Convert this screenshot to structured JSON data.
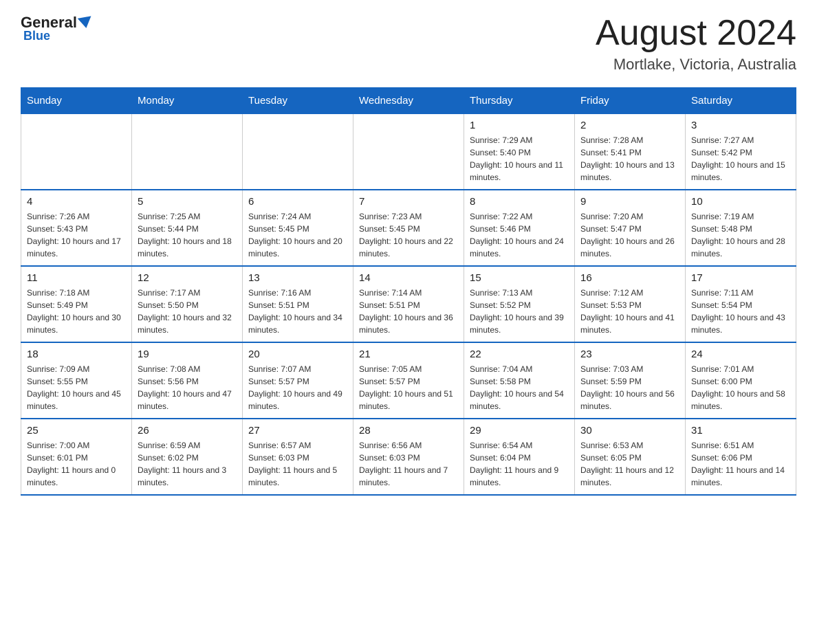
{
  "header": {
    "logo_general": "General",
    "logo_triangle": "",
    "logo_blue": "Blue",
    "month_year": "August 2024",
    "location": "Mortlake, Victoria, Australia"
  },
  "days_of_week": [
    "Sunday",
    "Monday",
    "Tuesday",
    "Wednesday",
    "Thursday",
    "Friday",
    "Saturday"
  ],
  "weeks": [
    [
      {
        "day": "",
        "info": ""
      },
      {
        "day": "",
        "info": ""
      },
      {
        "day": "",
        "info": ""
      },
      {
        "day": "",
        "info": ""
      },
      {
        "day": "1",
        "info": "Sunrise: 7:29 AM\nSunset: 5:40 PM\nDaylight: 10 hours and 11 minutes."
      },
      {
        "day": "2",
        "info": "Sunrise: 7:28 AM\nSunset: 5:41 PM\nDaylight: 10 hours and 13 minutes."
      },
      {
        "day": "3",
        "info": "Sunrise: 7:27 AM\nSunset: 5:42 PM\nDaylight: 10 hours and 15 minutes."
      }
    ],
    [
      {
        "day": "4",
        "info": "Sunrise: 7:26 AM\nSunset: 5:43 PM\nDaylight: 10 hours and 17 minutes."
      },
      {
        "day": "5",
        "info": "Sunrise: 7:25 AM\nSunset: 5:44 PM\nDaylight: 10 hours and 18 minutes."
      },
      {
        "day": "6",
        "info": "Sunrise: 7:24 AM\nSunset: 5:45 PM\nDaylight: 10 hours and 20 minutes."
      },
      {
        "day": "7",
        "info": "Sunrise: 7:23 AM\nSunset: 5:45 PM\nDaylight: 10 hours and 22 minutes."
      },
      {
        "day": "8",
        "info": "Sunrise: 7:22 AM\nSunset: 5:46 PM\nDaylight: 10 hours and 24 minutes."
      },
      {
        "day": "9",
        "info": "Sunrise: 7:20 AM\nSunset: 5:47 PM\nDaylight: 10 hours and 26 minutes."
      },
      {
        "day": "10",
        "info": "Sunrise: 7:19 AM\nSunset: 5:48 PM\nDaylight: 10 hours and 28 minutes."
      }
    ],
    [
      {
        "day": "11",
        "info": "Sunrise: 7:18 AM\nSunset: 5:49 PM\nDaylight: 10 hours and 30 minutes."
      },
      {
        "day": "12",
        "info": "Sunrise: 7:17 AM\nSunset: 5:50 PM\nDaylight: 10 hours and 32 minutes."
      },
      {
        "day": "13",
        "info": "Sunrise: 7:16 AM\nSunset: 5:51 PM\nDaylight: 10 hours and 34 minutes."
      },
      {
        "day": "14",
        "info": "Sunrise: 7:14 AM\nSunset: 5:51 PM\nDaylight: 10 hours and 36 minutes."
      },
      {
        "day": "15",
        "info": "Sunrise: 7:13 AM\nSunset: 5:52 PM\nDaylight: 10 hours and 39 minutes."
      },
      {
        "day": "16",
        "info": "Sunrise: 7:12 AM\nSunset: 5:53 PM\nDaylight: 10 hours and 41 minutes."
      },
      {
        "day": "17",
        "info": "Sunrise: 7:11 AM\nSunset: 5:54 PM\nDaylight: 10 hours and 43 minutes."
      }
    ],
    [
      {
        "day": "18",
        "info": "Sunrise: 7:09 AM\nSunset: 5:55 PM\nDaylight: 10 hours and 45 minutes."
      },
      {
        "day": "19",
        "info": "Sunrise: 7:08 AM\nSunset: 5:56 PM\nDaylight: 10 hours and 47 minutes."
      },
      {
        "day": "20",
        "info": "Sunrise: 7:07 AM\nSunset: 5:57 PM\nDaylight: 10 hours and 49 minutes."
      },
      {
        "day": "21",
        "info": "Sunrise: 7:05 AM\nSunset: 5:57 PM\nDaylight: 10 hours and 51 minutes."
      },
      {
        "day": "22",
        "info": "Sunrise: 7:04 AM\nSunset: 5:58 PM\nDaylight: 10 hours and 54 minutes."
      },
      {
        "day": "23",
        "info": "Sunrise: 7:03 AM\nSunset: 5:59 PM\nDaylight: 10 hours and 56 minutes."
      },
      {
        "day": "24",
        "info": "Sunrise: 7:01 AM\nSunset: 6:00 PM\nDaylight: 10 hours and 58 minutes."
      }
    ],
    [
      {
        "day": "25",
        "info": "Sunrise: 7:00 AM\nSunset: 6:01 PM\nDaylight: 11 hours and 0 minutes."
      },
      {
        "day": "26",
        "info": "Sunrise: 6:59 AM\nSunset: 6:02 PM\nDaylight: 11 hours and 3 minutes."
      },
      {
        "day": "27",
        "info": "Sunrise: 6:57 AM\nSunset: 6:03 PM\nDaylight: 11 hours and 5 minutes."
      },
      {
        "day": "28",
        "info": "Sunrise: 6:56 AM\nSunset: 6:03 PM\nDaylight: 11 hours and 7 minutes."
      },
      {
        "day": "29",
        "info": "Sunrise: 6:54 AM\nSunset: 6:04 PM\nDaylight: 11 hours and 9 minutes."
      },
      {
        "day": "30",
        "info": "Sunrise: 6:53 AM\nSunset: 6:05 PM\nDaylight: 11 hours and 12 minutes."
      },
      {
        "day": "31",
        "info": "Sunrise: 6:51 AM\nSunset: 6:06 PM\nDaylight: 11 hours and 14 minutes."
      }
    ]
  ]
}
